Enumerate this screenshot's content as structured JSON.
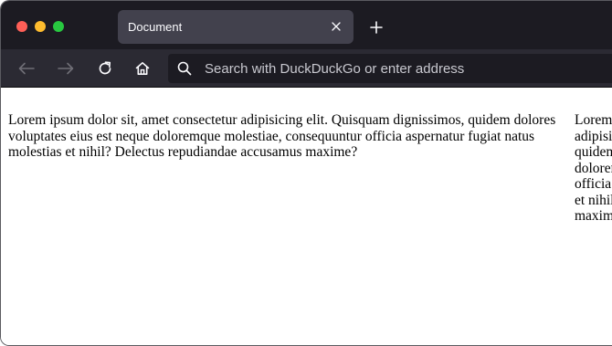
{
  "window": {
    "controls": [
      "close",
      "minimize",
      "zoom"
    ]
  },
  "tabs": [
    {
      "title": "Document",
      "active": true
    }
  ],
  "toolbar": {
    "back_icon": "arrow-left-icon",
    "forward_icon": "arrow-right-icon",
    "reload_icon": "reload-icon",
    "home_icon": "home-icon"
  },
  "urlbar": {
    "placeholder": "Search with DuckDuckGo or enter address",
    "value": ""
  },
  "page": {
    "paragraph_1": "Lorem ipsum dolor sit, amet consectetur adipisicing elit. Quisquam dignissimos, quidem dolores voluptates eius est neque doloremque molestiae, consequuntur officia aspernatur fugiat natus molestias et nihil? Delectus repudiandae accusamus maxime?",
    "paragraph_2": "Lorem ipsum dolor sit, amet consectetur adipisicing elit. Quisquam dignissimos, quidem dolores voluptates eius est neque doloremque molestiae, consequuntur officia aspernatur fugiat natus molestias et nihil? Delectus repudiandae accusamus maxime?"
  },
  "colors": {
    "tabstrip_bg": "#1c1b22",
    "toolbar_bg": "#2b2a33",
    "active_tab_bg": "#42414d",
    "urlbar_bg": "#1c1b22",
    "close_dot": "#ff5f57",
    "minimize_dot": "#febc2e",
    "zoom_dot": "#28c840"
  }
}
